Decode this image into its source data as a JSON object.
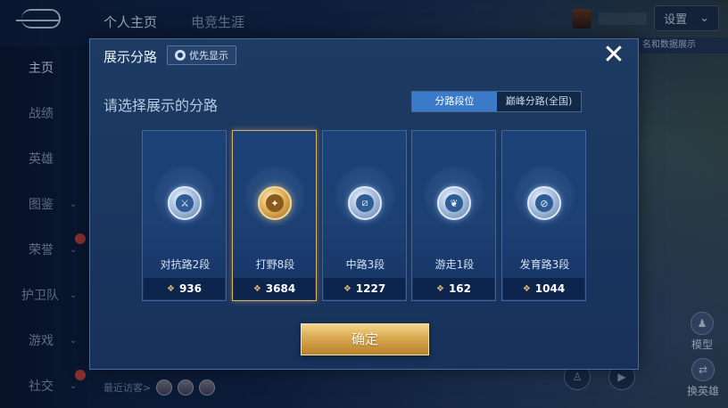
{
  "topbar": {
    "tabs": [
      {
        "label": "个人主页",
        "active": true
      },
      {
        "label": "电竞生涯",
        "active": false
      }
    ],
    "settings_label": "设置",
    "corner_text": "名和数据展示"
  },
  "sidebar": {
    "items": [
      {
        "label": "主页",
        "active": true,
        "chevron": false
      },
      {
        "label": "战绩",
        "active": false,
        "chevron": false
      },
      {
        "label": "英雄",
        "active": false,
        "chevron": false
      },
      {
        "label": "图鉴",
        "active": false,
        "chevron": true
      },
      {
        "label": "荣誉",
        "active": false,
        "chevron": true,
        "badge": true
      },
      {
        "label": "护卫队",
        "active": false,
        "chevron": true
      },
      {
        "label": "游戏",
        "active": false,
        "chevron": true
      },
      {
        "label": "社交",
        "active": false,
        "chevron": true,
        "badge": true
      }
    ],
    "recent_visitors_label": "最近访客>"
  },
  "right_buttons": {
    "model_label": "模型",
    "switch_hero_label": "换英雄"
  },
  "modal": {
    "title": "展示分路",
    "priority_button_label": "优先显示",
    "close_glyph": "✕",
    "subtitle": "请选择展示的分路",
    "segmented": {
      "options": [
        {
          "label": "分路段位",
          "active": true
        },
        {
          "label": "巅峰分路(全国)",
          "active": false
        }
      ]
    },
    "lanes": [
      {
        "label": "对抗路2段",
        "score": "936",
        "icon": "clash-lane-icon",
        "selected": false
      },
      {
        "label": "打野8段",
        "score": "3684",
        "icon": "jungle-dragon-icon",
        "selected": true
      },
      {
        "label": "中路3段",
        "score": "1227",
        "icon": "mid-lane-icon",
        "selected": false
      },
      {
        "label": "游走1段",
        "score": "162",
        "icon": "roam-wings-icon",
        "selected": false
      },
      {
        "label": "发育路3段",
        "score": "1044",
        "icon": "farm-lane-icon",
        "selected": false
      }
    ],
    "confirm_label": "确定",
    "colors": {
      "accent_blue": "#3b79c9",
      "gold": "#d9a94e",
      "selected_border": "#d8b06a"
    }
  }
}
